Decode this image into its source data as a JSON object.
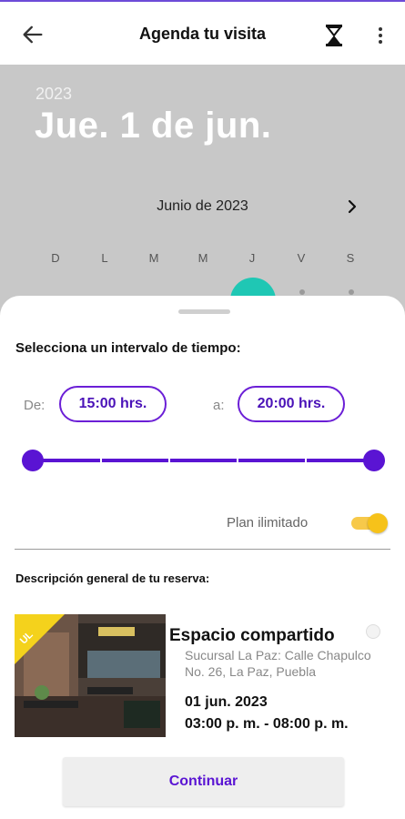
{
  "header": {
    "title": "Agenda tu visita",
    "back_icon": "arrow-left-icon",
    "timer_icon": "hourglass-icon",
    "menu_icon": "more-vert-icon"
  },
  "calendar": {
    "year": "2023",
    "selected_date": "Jue. 1 de jun.",
    "month": "Junio de 2023",
    "weekdays": [
      "D",
      "L",
      "M",
      "M",
      "J",
      "V",
      "S"
    ],
    "selected_color": "#1fc7b4"
  },
  "sheet": {
    "interval_title": "Selecciona un intervalo de tiempo:",
    "from_label": "De:",
    "from_value": "15:00 hrs.",
    "to_label": "a:",
    "to_value": "20:00 hrs.",
    "plan_label": "Plan ilimitado",
    "plan_enabled": true,
    "description_title": "Descripción general de tu reserva:"
  },
  "reservation": {
    "badge": "UL",
    "title": "Espacio compartido",
    "address": "Sucursal La Paz: Calle Chapulco No. 26, La Paz, Puebla",
    "date": "01 jun. 2023",
    "time": "03:00 p. m. - 08:00 p. m."
  },
  "actions": {
    "continue_label": "Continuar"
  },
  "colors": {
    "accent": "#5a14d3",
    "toggle": "#f6c21a"
  }
}
